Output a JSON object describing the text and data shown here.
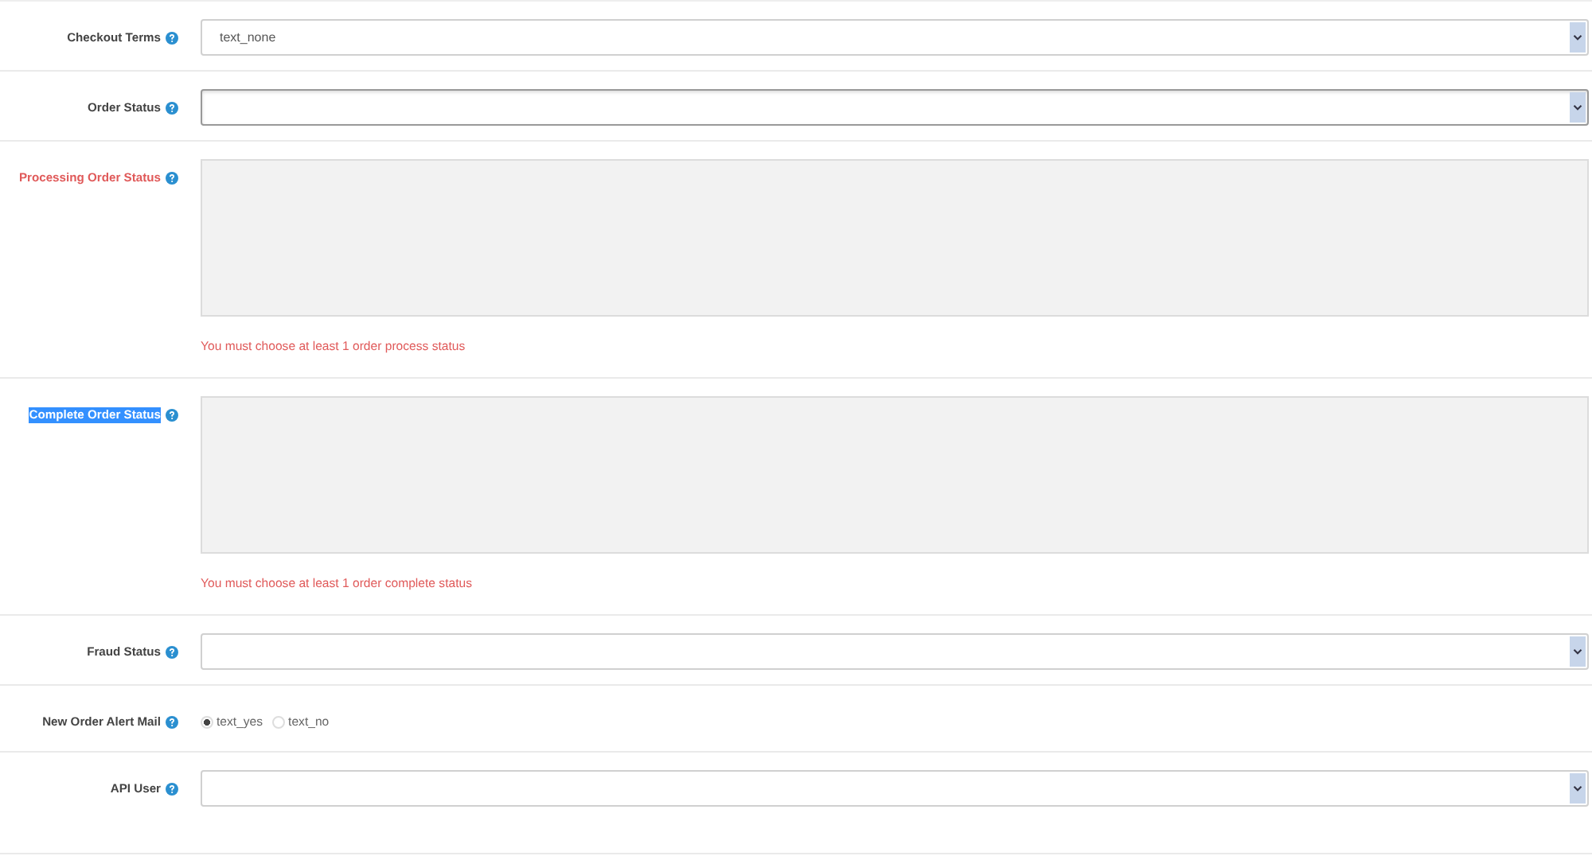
{
  "fields": [
    {
      "kind": "select",
      "label": "Checkout Terms",
      "error_label": false,
      "highlighted": false,
      "focused": false,
      "value": "text_none"
    },
    {
      "kind": "select",
      "label": "Order Status",
      "error_label": false,
      "highlighted": false,
      "focused": true
    },
    {
      "kind": "multiselect",
      "label": "Processing Order Status",
      "error_label": true,
      "highlighted": false,
      "error": "You must choose at least 1 order process status"
    },
    {
      "kind": "multiselect",
      "label": "Complete Order Status",
      "error_label": false,
      "highlighted": true,
      "error": "You must choose at least 1 order complete status"
    },
    {
      "kind": "select",
      "label": "Fraud Status",
      "error_label": false,
      "highlighted": false,
      "focused": false
    },
    {
      "kind": "radio",
      "label": "New Order Alert Mail",
      "error_label": false,
      "highlighted": false,
      "options": [
        {
          "label": "text_yes",
          "selected": true
        },
        {
          "label": "text_no",
          "selected": false
        }
      ]
    },
    {
      "kind": "select",
      "label": "API User",
      "error_label": false,
      "highlighted": false,
      "focused": false
    }
  ]
}
